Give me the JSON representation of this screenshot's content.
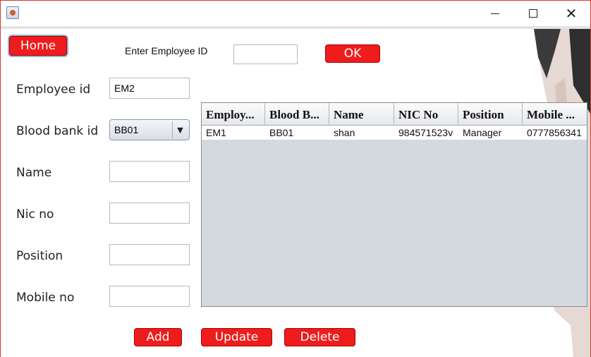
{
  "window": {
    "controls": {
      "minimize_icon": "minimize-icon",
      "maximize_icon": "maximize-icon",
      "close_icon": "close-icon",
      "close_glyph": "✕"
    }
  },
  "nav": {
    "home_label": "Home"
  },
  "search": {
    "label": "Enter Employee ID",
    "value": "",
    "ok_label": "OK"
  },
  "form": {
    "employee_id": {
      "label": "Employee id",
      "value": "EM2"
    },
    "blood_bank_id": {
      "label": "Blood bank id",
      "value": "BB01",
      "arrow": "▼"
    },
    "name": {
      "label": "Name",
      "value": ""
    },
    "nic_no": {
      "label": "Nic no",
      "value": ""
    },
    "position": {
      "label": "Position",
      "value": ""
    },
    "mobile_no": {
      "label": "Mobile no",
      "value": ""
    }
  },
  "table": {
    "columns": [
      "Employ...",
      "Blood B...",
      "Name",
      "NIC No",
      "Position",
      "Mobile ..."
    ],
    "rows": [
      [
        "EM1",
        "BB01",
        "shan",
        "984571523v",
        "Manager",
        "0777856341"
      ]
    ]
  },
  "actions": {
    "add_label": "Add",
    "update_label": "Update",
    "delete_label": "Delete"
  },
  "colors": {
    "accent": "#ee1c1c",
    "table_bg": "#d4d8df"
  }
}
